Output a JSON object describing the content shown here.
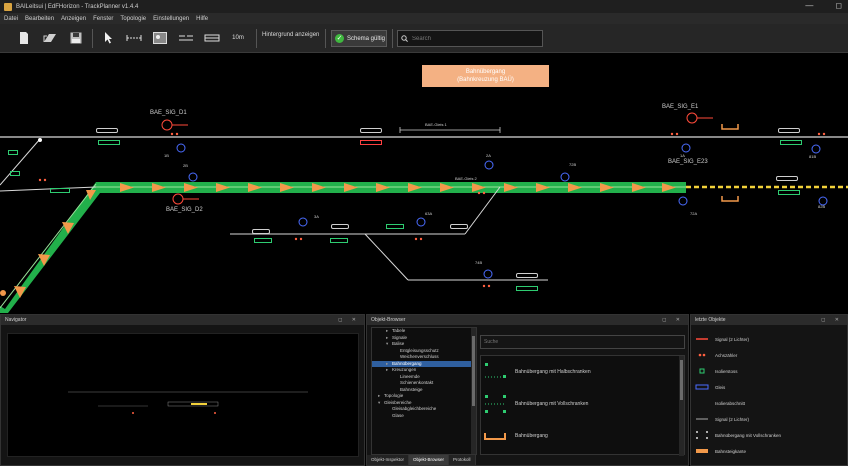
{
  "window": {
    "title": "BAILeitsui | EdFHorizon - TrackPlanner v1.4.4",
    "controls": {
      "minimize": "—",
      "restore": "◻"
    }
  },
  "menu": [
    "Datei",
    "Bearbeiten",
    "Anzeigen",
    "Fenster",
    "Topologie",
    "Einstellungen",
    "Hilfe"
  ],
  "toolbar": {
    "scale_label": "10m",
    "background_button": "Hintergrund anzeigen",
    "schema_button": "Schema gültig",
    "search_placeholder": "Search"
  },
  "canvas": {
    "notice_lines": [
      "Bahnübergang",
      "(Bahnkreuzung BAÜ)"
    ],
    "signals": {
      "sig_d1": "BAE_SIG_D1",
      "sig_d2": "BAE_SIG_D2",
      "sig_e1": "BAE_SIG_E1",
      "sig_e23": "BAE_SIG_E23"
    },
    "track_labels": {
      "gleis_1": "BAE-Gleis 1",
      "gleis_2": "BAE-Gleis 2"
    },
    "numbers": {
      "n1b": "1B",
      "n2b": "2B",
      "n2a": "2A",
      "n72b": "72B",
      "n1a": "1A",
      "n3a": "3A",
      "n63a": "63A",
      "n74b": "74B",
      "n72a": "72A",
      "n81b": "81B",
      "n82b": "82B"
    }
  },
  "panels": {
    "navigator": {
      "title": "Navigator",
      "buttons": "◻ ✕"
    },
    "browser": {
      "title": "Objekt-Browser",
      "buttons": "◻ ✕",
      "tree": [
        {
          "label": "Tabele",
          "indent": 1,
          "arrow": "▸"
        },
        {
          "label": "Signale",
          "indent": 1,
          "arrow": "▸"
        },
        {
          "label": "Balise",
          "indent": 1,
          "arrow": "▾"
        },
        {
          "label": "Entgleisungsschutz",
          "indent": 2,
          "arrow": ""
        },
        {
          "label": "Weichenverschluss",
          "indent": 2,
          "arrow": ""
        },
        {
          "label": "Bahnübergang",
          "indent": 1,
          "arrow": "▸",
          "selected": true
        },
        {
          "label": "Kreuzungen",
          "indent": 1,
          "arrow": "▸"
        },
        {
          "label": "Lineemde",
          "indent": 2,
          "arrow": ""
        },
        {
          "label": "Schienenkontakt",
          "indent": 2,
          "arrow": ""
        },
        {
          "label": "Bahnsteige",
          "indent": 2,
          "arrow": ""
        },
        {
          "label": "Topologie",
          "indent": 0,
          "arrow": "▸"
        },
        {
          "label": "Gleisbereiche",
          "indent": 0,
          "arrow": "▾"
        },
        {
          "label": "Gleisabgleichbereiche",
          "indent": 1,
          "arrow": ""
        },
        {
          "label": "Glase",
          "indent": 1,
          "arrow": ""
        }
      ],
      "search_placeholder": "Suche",
      "items": [
        "Bahnübergang mit Halbschranken",
        "Bahnübergang mit Vollschranken",
        "Bahnübergang"
      ],
      "tabs": [
        "Objekt-Inspektor",
        "Objekt-Browser",
        "Protokoll"
      ],
      "active_tab": "Objekt-Browser"
    },
    "recent": {
      "title": "letzte Objekte",
      "buttons": "◻ ✕",
      "items": [
        "Signal (2 Lichter)",
        "Achszähler",
        "Isolierstoss",
        "Gleis",
        "Isolierabschnitt",
        "Signal (2 Lichter)",
        "Bahnübergang mit Vollschranken",
        "Bahnsteigkante"
      ]
    }
  },
  "colors": {
    "route_green": "#22b04b",
    "arrow_orange": "#f2994a",
    "signal_red": "#ff4a3a",
    "dash_yellow": "#f2d13a",
    "selection_blue": "#2f5f9f",
    "notice_orange": "#f4b183"
  }
}
